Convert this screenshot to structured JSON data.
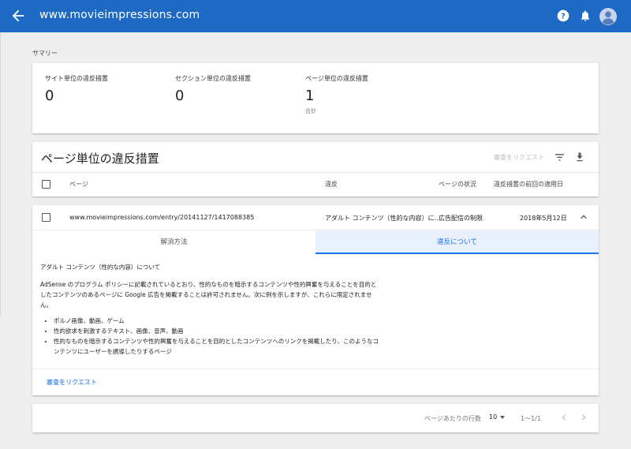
{
  "topbar": {
    "site": "www.movieimpressions.com",
    "icons": [
      "arrow-back-icon",
      "help-icon",
      "bell-icon",
      "account-avatar-icon"
    ],
    "color": "#1d69c3"
  },
  "summary": {
    "title": "サマリー",
    "metrics": [
      {
        "label": "サイト単位の違反措置",
        "value": "0"
      },
      {
        "label": "セクション単位の違反措置",
        "value": "0"
      },
      {
        "label": "ページ単位の違反措置",
        "value": "1",
        "sub": "合計"
      }
    ]
  },
  "page_violations": {
    "title": "ページ単位の違反措置",
    "request_review": "審査をリクエスト",
    "columns": [
      "ページ",
      "違反",
      "ページの状況",
      "違反措置の前回の適用日"
    ]
  },
  "row": {
    "page": "www.movieimpressions.com/entry/20141127/1417088385",
    "violation": "アダルト コンテンツ（性的な内容）に...",
    "status": "広告配信の制限",
    "date": "2018年5月12日",
    "tabs": [
      "解消方法",
      "違反について"
    ],
    "active_tab": 1,
    "detail": {
      "heading": "アダルト コンテンツ（性的な内容）について",
      "paragraph": "AdSense のプログラム ポリシーに記載されているとおり、性的なものを暗示するコンテンツや性的興奮を与えることを目的としたコンテンツのあるページに Google 広告を掲載することは許可されません。次に例を示しますが、これらに限定されません。",
      "bullets": [
        "ポルノ画像、動画、ゲーム",
        "性的欲求を刺激するテキスト、画像、音声、動画",
        "性的なものを暗示するコンテンツや性的興奮を与えることを目的としたコンテンツへのリンクを掲載したり、このようなコンテンツにユーザーを誘導したりするページ"
      ]
    },
    "request_review": "審査をリクエスト"
  },
  "pagination": {
    "rows_label": "ページあたりの行数",
    "page_size": "10",
    "range": "1～1/1"
  }
}
